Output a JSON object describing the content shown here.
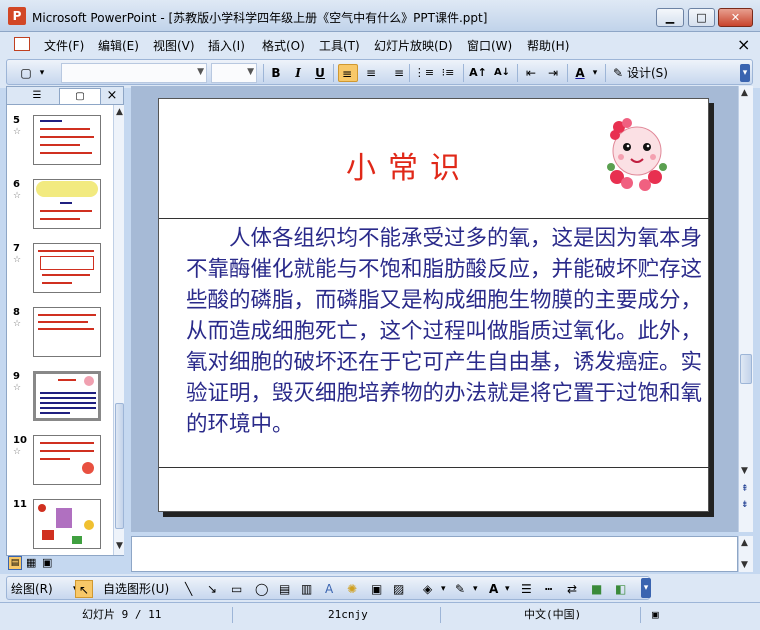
{
  "window": {
    "title": "Microsoft PowerPoint - [苏教版小学科学四年级上册《空气中有什么》PPT课件.ppt]",
    "min_glyph": "▁",
    "max_glyph": "□",
    "close_glyph": "✕"
  },
  "menu": {
    "items": [
      "文件(F)",
      "编辑(E)",
      "视图(V)",
      "插入(I)",
      "格式(O)",
      "工具(T)",
      "幻灯片放映(D)",
      "窗口(W)",
      "帮助(H)"
    ],
    "close_glyph": "×"
  },
  "toolbar": {
    "new_glyph": "▢",
    "font_name": "",
    "font_size": "",
    "bold": "B",
    "italic": "I",
    "underline": "U",
    "align_left": "≡",
    "center": "≡",
    "align_right": "≡",
    "numbering": "⋮≡",
    "bullets": "⁝≡",
    "grow_font": "A↑",
    "shrink_font": "A↓",
    "decrease_indent": "⇤",
    "increase_indent": "⇥",
    "font_color": "A",
    "design_label": "设计(S)"
  },
  "left_panel": {
    "outline_tab_glyph": "☰",
    "slides_tab_glyph": "▢",
    "close_glyph": "×",
    "star_glyph": "☆",
    "slides": [
      {
        "number": "5"
      },
      {
        "number": "6"
      },
      {
        "number": "7"
      },
      {
        "number": "8"
      },
      {
        "number": "9",
        "selected": true
      },
      {
        "number": "10"
      },
      {
        "number": "11"
      }
    ]
  },
  "slide": {
    "title": "小常识",
    "body": "人体各组织均不能承受过多的氧，这是因为氧本身不靠酶催化就能与不饱和脂肪酸反应，并能破坏贮存这些酸的磷脂，而磷脂又是构成细胞生物膜的主要成分，从而造成细胞死亡，这个过程叫做脂质过氧化。此外，氧对细胞的破坏还在于它可产生自由基，诱发癌症。实验证明，毁灭细胞培养物的办法就是将它置于过饱和氧的环境中。",
    "title_color": "#e02818",
    "body_color": "#2a2a8a"
  },
  "drawing_toolbar": {
    "draw_label": "绘图(R)",
    "autoshapes_label": "自选图形(U)"
  },
  "status": {
    "slide_info": "幻灯片 9 / 11",
    "design_name": "21cnjy",
    "language": "中文(中国)"
  }
}
